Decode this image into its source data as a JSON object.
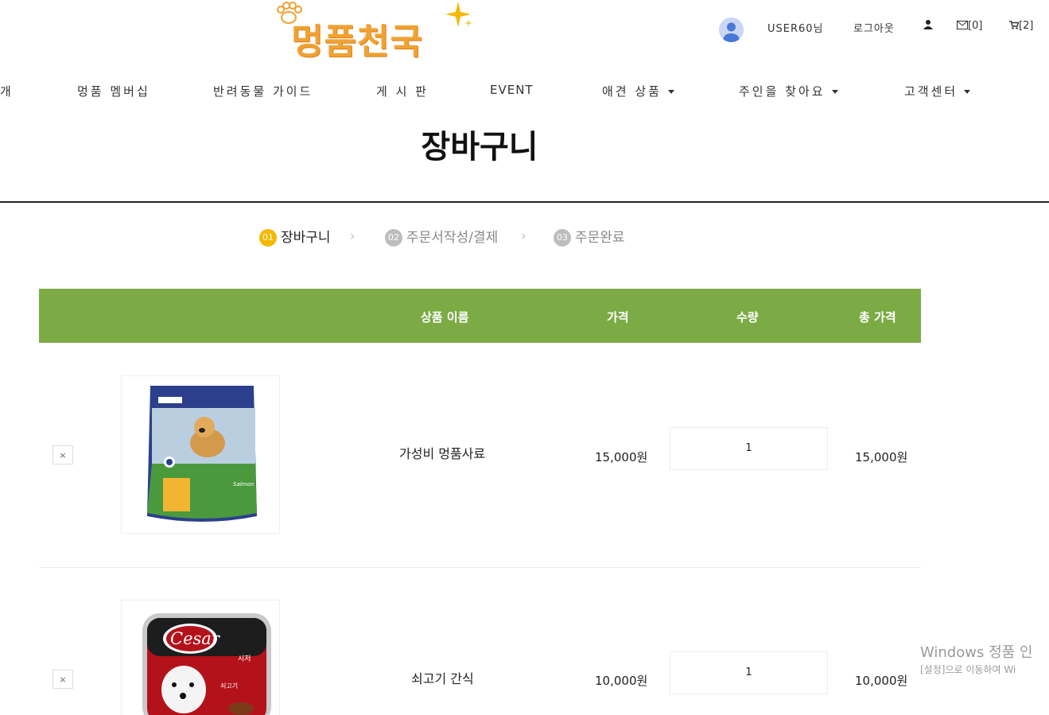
{
  "logo": {
    "text": "멍품천국"
  },
  "topbar": {
    "user": "USER60님",
    "logout": "로그아웃",
    "person_icon": "person-icon",
    "mail_count": "[0]",
    "cart_count": "[2]"
  },
  "nav": [
    {
      "label": "개"
    },
    {
      "label": "멍품 멤버십"
    },
    {
      "label": "반려동물 가이드"
    },
    {
      "label": "게 시 판"
    },
    {
      "label": "EVENT"
    },
    {
      "label": "애견 상품"
    },
    {
      "label": "주인을 찾아요"
    },
    {
      "label": "고객센터"
    }
  ],
  "page_title": "장바구니",
  "steps": [
    {
      "num": "01",
      "label": "장바구니"
    },
    {
      "num": "02",
      "label": "주문서작성/결제"
    },
    {
      "num": "03",
      "label": "주문완료"
    }
  ],
  "table": {
    "headers": {
      "name": "상품 이름",
      "price": "가격",
      "qty": "수량",
      "total": "총 가격"
    },
    "rows": [
      {
        "remove": "×",
        "name": "가성비 멍품사료",
        "price": "15,000원",
        "qty": "1",
        "total": "15,000원"
      },
      {
        "remove": "×",
        "name": "쇠고기 간식",
        "price": "10,000원",
        "qty": "1",
        "total": "10,000원"
      }
    ]
  },
  "watermark": {
    "line1": "Windows 정품 인",
    "line2": "[설정]으로 이동하여 Wi"
  },
  "colors": {
    "accent_green": "#7cab45",
    "step_active": "#f5b800",
    "logo_orange": "#f0a232"
  }
}
